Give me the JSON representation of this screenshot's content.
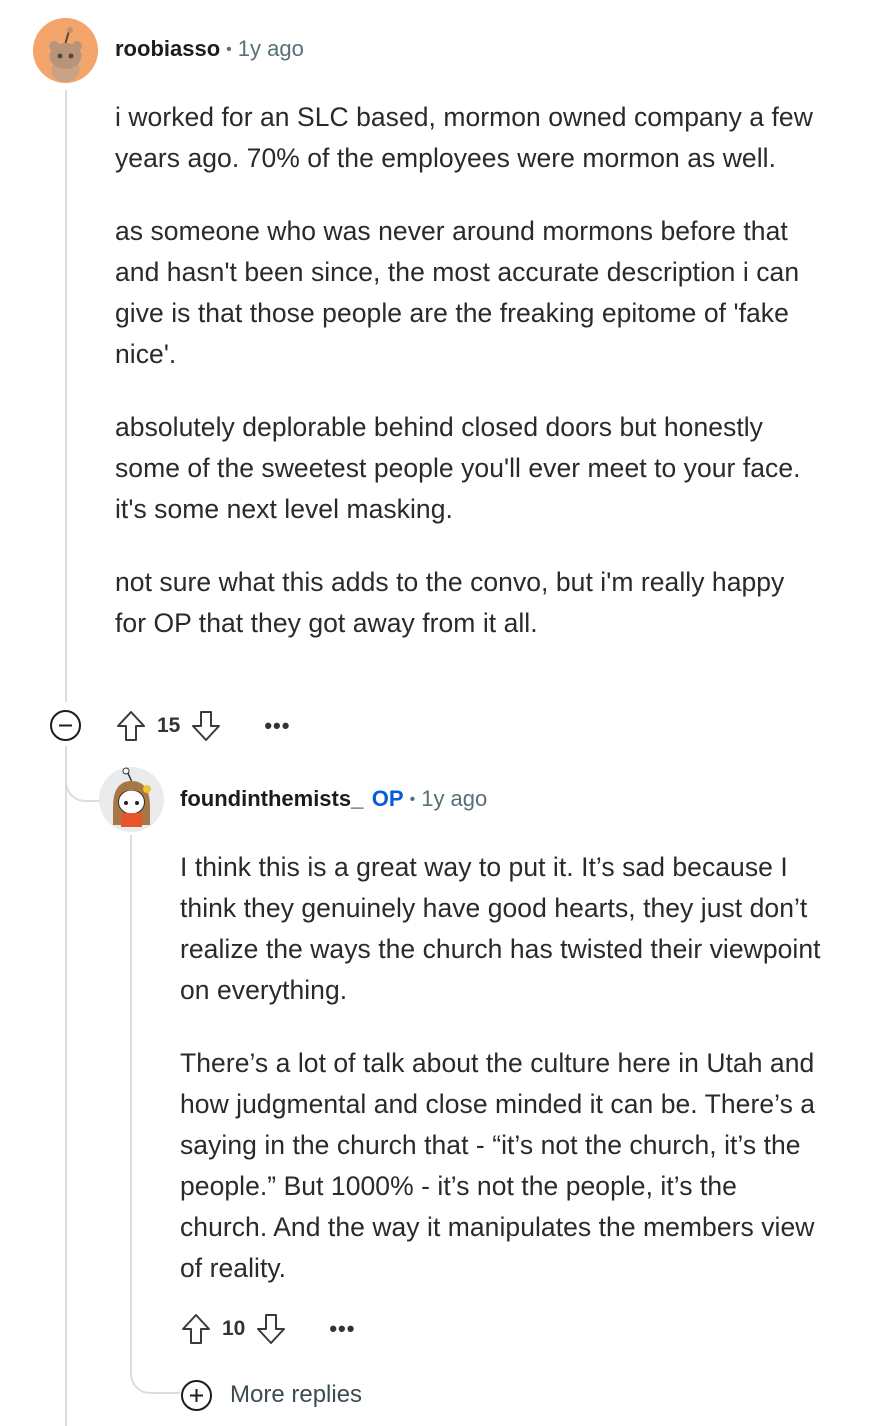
{
  "comment": {
    "username": "roobiasso",
    "time": "1y ago",
    "avatar_icon": "snoo-avatar-icon",
    "paragraphs": [
      "i worked for an SLC based, mormon owned company a few years ago. 70% of the employees were mormon as well.",
      "as someone who was never around mormons before that and hasn't been since, the most accurate description i can give is that those people are the freaking epitome of 'fake nice'.",
      "absolutely deplorable behind closed doors but honestly some of the sweetest people you'll ever meet to your face. it's some next level masking.",
      "not sure what this adds to the convo, but i'm really happy for OP that they got away from it all."
    ],
    "votes": "15",
    "more_label": "•••"
  },
  "reply": {
    "username": "foundinthemists_",
    "op_badge": "OP",
    "time": "1y ago",
    "avatar_icon": "snoo-avatar-icon",
    "paragraphs": [
      "I think this is a great way to put it. It’s sad because I think they genuinely have good hearts, they just don’t realize the ways the church has twisted their viewpoint on everything.",
      "There’s a lot of talk about the culture here in Utah and how judgmental and close minded it can be. There’s a saying in the church that - “it’s not the church, it’s the people.” But 1000% - it’s not the people, it’s the church. And the way it manipulates the members view of reality."
    ],
    "votes": "10",
    "more_label": "•••"
  },
  "more_replies_label": "More replies",
  "colors": {
    "accent_op": "#0a5bd8",
    "meta_text": "#576f76",
    "thread_line": "#dadde1",
    "avatar1_bg": "#f4a56b"
  }
}
